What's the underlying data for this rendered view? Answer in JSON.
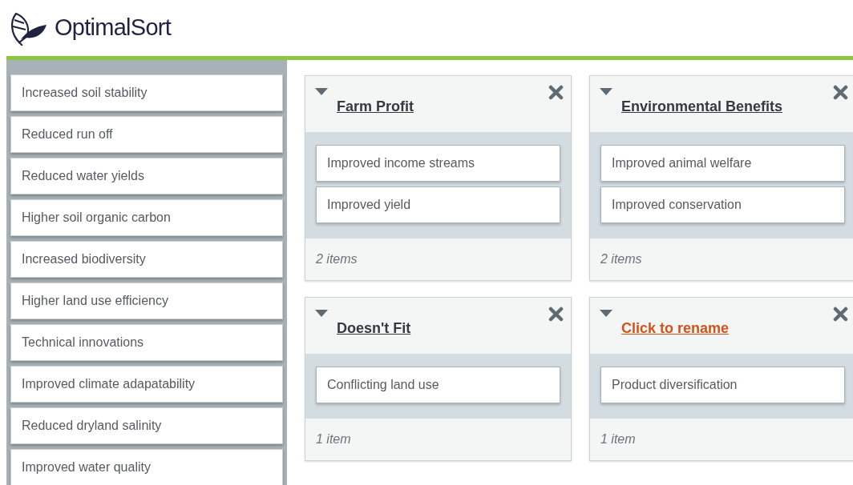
{
  "brand": {
    "name": "OptimalSort"
  },
  "cards": [
    "Increased soil stability",
    "Reduced run off",
    "Reduced water yields",
    "Higher soil organic carbon",
    "Increased biodiversity",
    "Higher land use efficiency",
    "Technical innovations",
    "Improved climate adapatability",
    "Reduced dryland salinity",
    "Improved water quality"
  ],
  "categories": [
    {
      "title": "Farm Profit",
      "kind": "named",
      "cards": [
        "Improved income streams",
        "Improved yield"
      ],
      "count": "2 items"
    },
    {
      "title": "Environmental Benefits",
      "kind": "named",
      "cards": [
        "Improved animal welfare",
        "Improved conservation"
      ],
      "count": "2 items"
    },
    {
      "title": "Doesn't Fit",
      "kind": "named",
      "cards": [
        "Conflicting land use"
      ],
      "count": "1 item"
    },
    {
      "title": "Click to rename",
      "kind": "unnamed",
      "cards": [
        "Product diversification"
      ],
      "count": "1 item"
    }
  ]
}
